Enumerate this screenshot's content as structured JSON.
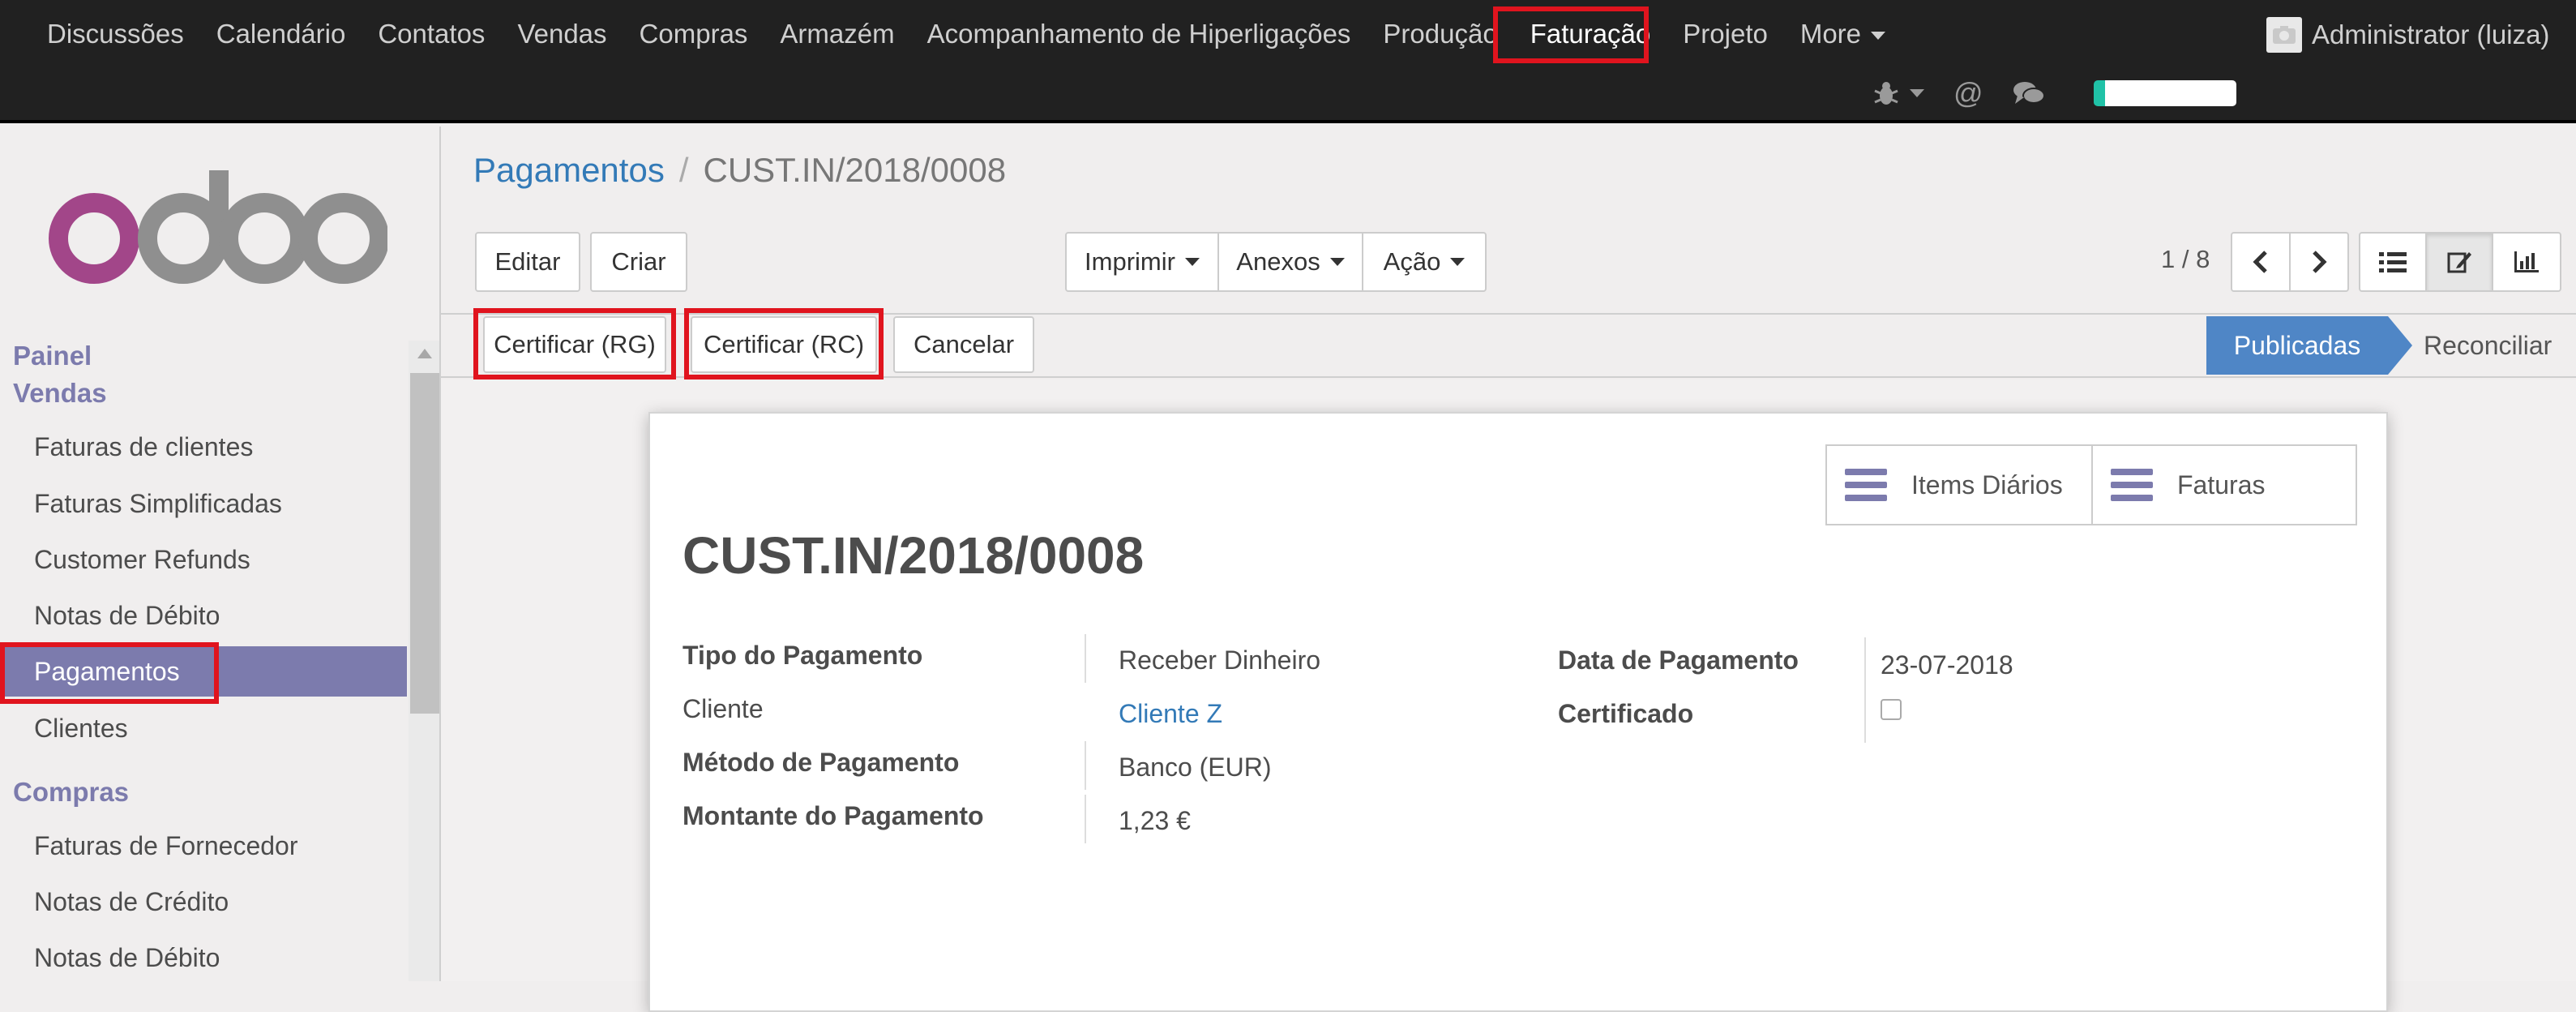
{
  "topnav": {
    "menu": [
      "Discussões",
      "Calendário",
      "Contatos",
      "Vendas",
      "Compras",
      "Armazém",
      "Acompanhamento de Hiperligações",
      "Produção",
      "Faturação",
      "Projeto"
    ],
    "more_label": "More",
    "user_label": "Administrator (luiza)"
  },
  "sidebar": {
    "brand": "odoo",
    "sections": [
      {
        "title": "Painel"
      },
      {
        "title": "Vendas",
        "items": [
          "Faturas de clientes",
          "Faturas Simplificadas",
          "Customer Refunds",
          "Notas de Débito",
          "Pagamentos",
          "Clientes"
        ]
      },
      {
        "title": "Compras",
        "items": [
          "Faturas de Fornecedor",
          "Notas de Crédito",
          "Notas de Débito"
        ]
      }
    ]
  },
  "breadcrumb": {
    "parent": "Pagamentos",
    "sep": "/",
    "current": "CUST.IN/2018/0008"
  },
  "toolbar": {
    "edit": "Editar",
    "create": "Criar",
    "print": "Imprimir",
    "attachments": "Anexos",
    "action": "Ação",
    "pager": "1 / 8"
  },
  "statusbar": {
    "buttons": [
      "Certificar (RG)",
      "Certificar (RC)",
      "Cancelar"
    ],
    "stages": {
      "active": "Publicadas",
      "next": "Reconciliar"
    }
  },
  "form": {
    "smart_buttons": [
      "Items Diários",
      "Faturas"
    ],
    "title": "CUST.IN/2018/0008",
    "fields_left": [
      {
        "label": "Tipo do Pagamento",
        "value": "Receber Dinheiro"
      },
      {
        "label": "Cliente",
        "value": "Cliente Z"
      },
      {
        "label": "Método de Pagamento",
        "value": "Banco (EUR)"
      },
      {
        "label": "Montante do Pagamento",
        "value": "1,23 €"
      }
    ],
    "fields_right": [
      {
        "label": "Data de Pagamento",
        "value": "23-07-2018"
      },
      {
        "label": "Certificado",
        "checked": false
      }
    ]
  },
  "colors": {
    "brand_purple": "#7c7bad",
    "primary_blue": "#4f86c6",
    "link": "#337ab7",
    "highlight_red": "#e0141e"
  }
}
